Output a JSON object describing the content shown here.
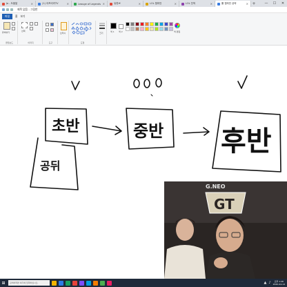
{
  "browser": {
    "tabs": [
      {
        "label": "Jo - 도움말",
        "color": "#e04b3a",
        "active": false
      },
      {
        "label": "(1) 아프리카TV",
        "color": "#3a7de0",
        "active": false
      },
      {
        "label": "Leauge of Legends",
        "color": "#2fa84f",
        "active": false
      },
      {
        "label": "유튜브",
        "color": "#e04b3a",
        "active": false
      },
      {
        "label": "LOL 챔피언",
        "color": "#d9a400",
        "active": false
      },
      {
        "label": "LOL 전적",
        "color": "#8e44ad",
        "active": false
      },
      {
        "label": "롤 챔피언 공략",
        "color": "#3a7de0",
        "active": true
      }
    ],
    "new_tab_symbol": "+",
    "window_controls": [
      "—",
      "☐",
      "✕"
    ]
  },
  "paint": {
    "title": "제목 없음 - 그림판",
    "file_menu": "파일",
    "menu_tabs": [
      "홈",
      "보기"
    ],
    "groups": {
      "clipboard": "클립보드",
      "image": "이미지",
      "tools": "도구",
      "brush": "브러시",
      "shapes": "도형",
      "size": "크기",
      "colors": "색"
    },
    "labels": {
      "paste": "붙여넣기",
      "select": "선택",
      "brush": "브러시",
      "size": "크기",
      "color1": "색 1",
      "color2": "색 2",
      "edit_colors": "색 편집"
    },
    "palette": [
      "#000000",
      "#7f7f7f",
      "#880015",
      "#ed1c24",
      "#ff7f27",
      "#fff200",
      "#22b14c",
      "#00a2e8",
      "#3f48cc",
      "#a349a4",
      "#ffffff",
      "#c3c3c3",
      "#b97a57",
      "#ffaec9",
      "#ffc90e",
      "#efe4b0",
      "#b5e61d",
      "#99d9ea",
      "#7092be",
      "#c8bfe7"
    ],
    "color1": "#000000",
    "color2": "#ffffff"
  },
  "drawing": {
    "boxes": [
      {
        "text": "초반",
        "mark": "V"
      },
      {
        "text": "중반",
        "mark": "OOO"
      },
      {
        "text": "후반",
        "mark": "✓"
      },
      {
        "text": "공뒤",
        "mark": ""
      }
    ],
    "stroke_color": "#111111"
  },
  "stream": {
    "brand_text": "G.NEO",
    "logo_text": "GT"
  },
  "taskbar": {
    "search_placeholder": "검색하려면 여기에 입력하십시오.",
    "time": "오후 1:26",
    "date": "2020-04-14",
    "icon_colors": [
      "#f3b300",
      "#2d7be5",
      "#1aa260",
      "#e6433a",
      "#7c4dff",
      "#00a0e0",
      "#f57c00",
      "#4caf50",
      "#e91e63"
    ]
  }
}
